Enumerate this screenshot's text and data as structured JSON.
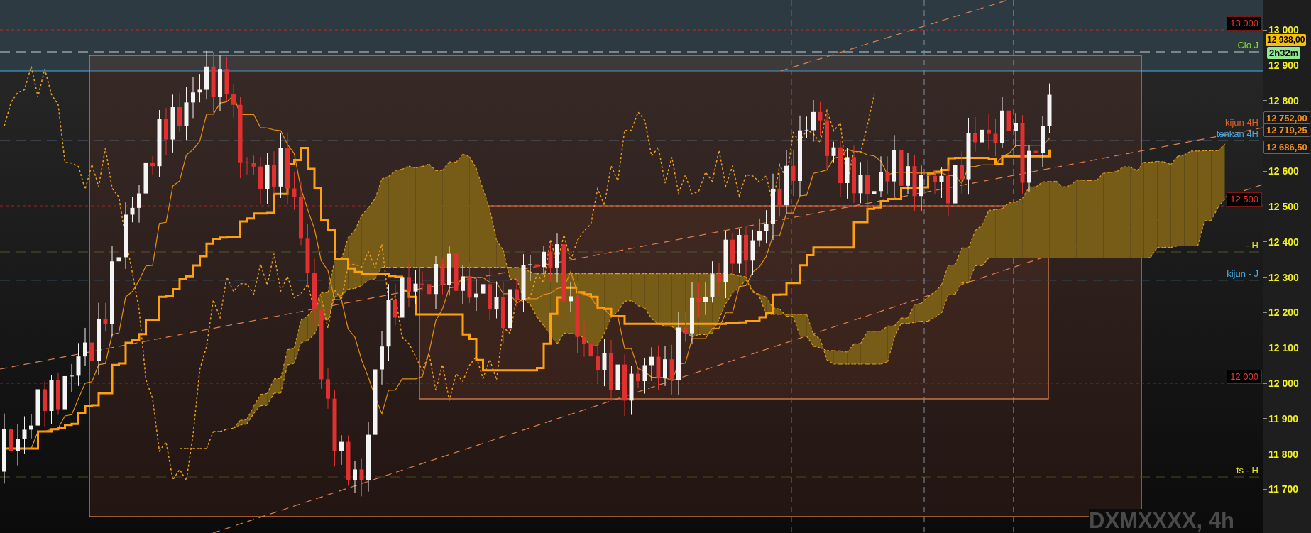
{
  "chart": {
    "symbol": "DXMXXXX, 4h",
    "price_axis": [
      "13 000",
      "12 900",
      "12 800",
      "12 600",
      "12 500",
      "12 400",
      "12 300",
      "12 200",
      "12 100",
      "12 000",
      "11 900",
      "11 800",
      "11 700"
    ],
    "level_boxes": [
      "13 000",
      "12 500",
      "12 000"
    ],
    "line_labels": [
      {
        "text": "Clo J",
        "color": "#88dd22"
      },
      {
        "text": "kijun 4H",
        "color": "#e0602a"
      },
      {
        "text": "tenkan 4H",
        "color": "#4aa8e0"
      },
      {
        "text": "- H",
        "color": "#e8e820"
      },
      {
        "text": "kijun - J",
        "color": "#4aa8e0"
      },
      {
        "text": "ts - H",
        "color": "#e8e820"
      }
    ],
    "price_tags": [
      {
        "text": "12 938,00",
        "kind": "last"
      },
      {
        "text": "2h32m",
        "kind": "timer"
      },
      {
        "text": "12 752,00",
        "kind": "line"
      },
      {
        "text": "12 719,25",
        "kind": "line"
      },
      {
        "text": "12 686,50",
        "kind": "line"
      }
    ]
  }
}
